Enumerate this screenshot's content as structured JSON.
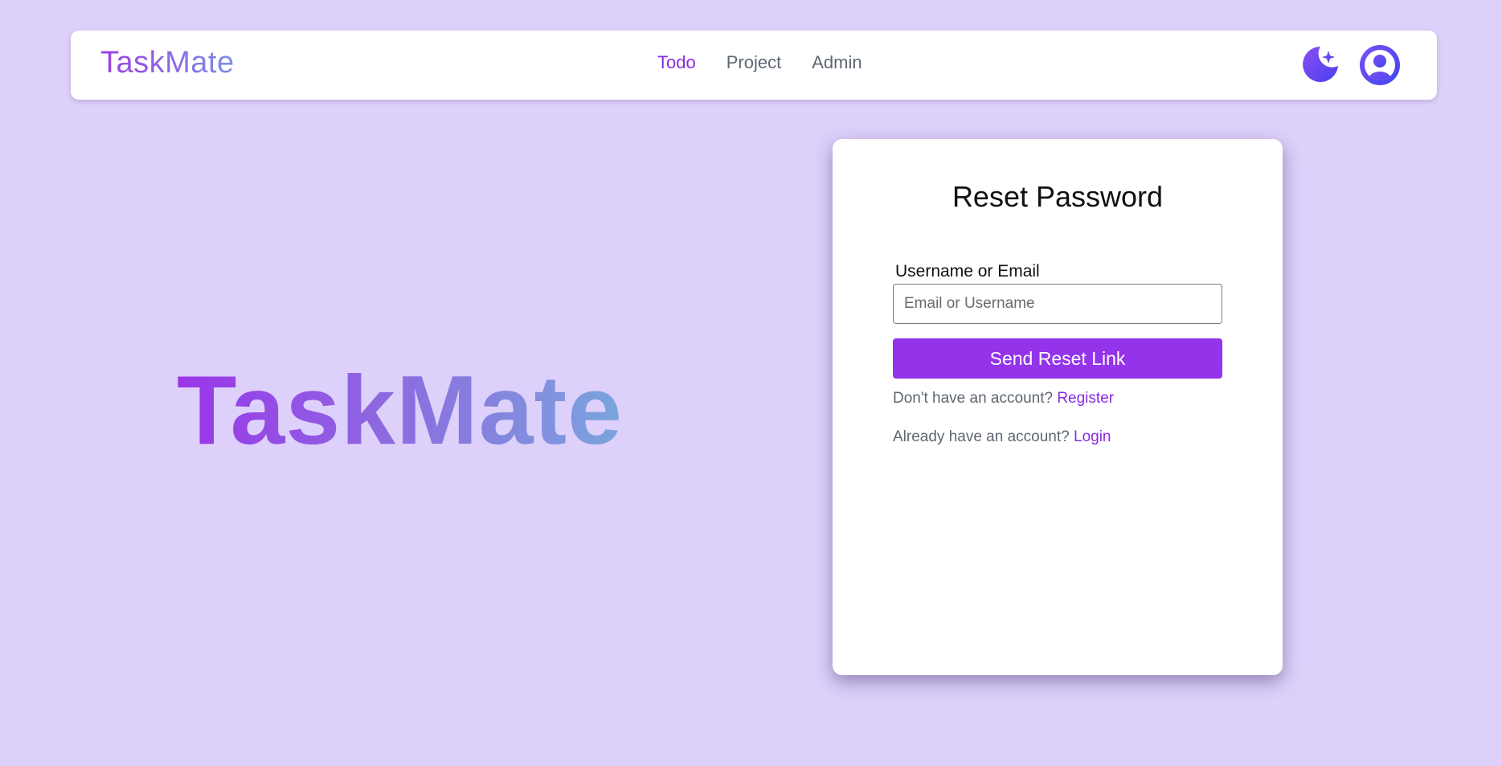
{
  "navbar": {
    "brand": "TaskMate",
    "links": [
      {
        "label": "Todo",
        "active": true
      },
      {
        "label": "Project",
        "active": false
      },
      {
        "label": "Admin",
        "active": false
      }
    ],
    "theme_toggle_icon": "moon-star-icon",
    "user_icon": "user-avatar-icon"
  },
  "hero": {
    "title": "TaskMate"
  },
  "reset_form": {
    "title": "Reset Password",
    "field_label": "Username or Email",
    "field_placeholder": "Email or Username",
    "field_value": "",
    "submit_label": "Send Reset Link",
    "register_prompt": "Don't have an account?",
    "register_link": "Register",
    "login_prompt": "Already have an account?",
    "login_link": "Login"
  },
  "colors": {
    "background": "#ddd0fa",
    "accent": "#9333ea",
    "link": "#8a2be2",
    "icon": "#5b4ff0"
  }
}
